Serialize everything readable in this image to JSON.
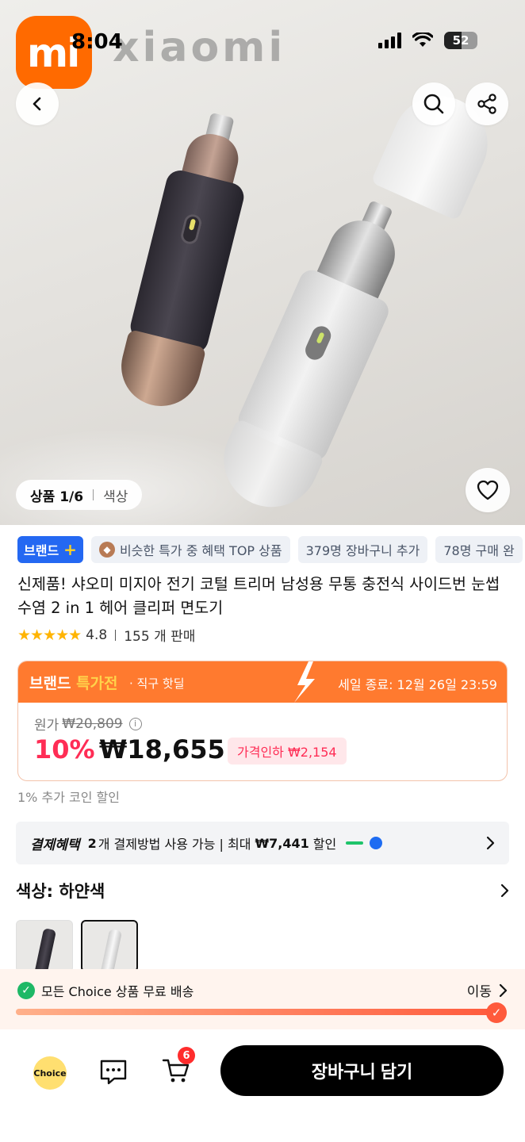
{
  "status": {
    "time": "8:04",
    "battery": "52"
  },
  "hero": {
    "brand_logo": "mi",
    "brand_word": "xiaomi",
    "image_counter": "상품 1/6",
    "image_tab": "색상"
  },
  "tags": {
    "brand": "브랜드",
    "brand_plus": "+",
    "similar": "비슷한 특가 중 혜택 TOP 상품",
    "cart_added": "379명 장바구니 추가",
    "purchased": "78명 구매 완"
  },
  "product": {
    "title": "신제품! 샤오미 미지아 전기 코털 트리머 남성용 무통 충전식 사이드번 눈썹 수염 2 in 1 헤어 클리퍼 면도기",
    "stars": "★★★★★",
    "rating": "4.8",
    "sold": "155 개 판매"
  },
  "promo": {
    "brand_label": "브랜드",
    "sale_label": "특가전",
    "sub": "· 직구 핫딜",
    "end": "세일 종료: 12월 26일 23:59"
  },
  "price": {
    "orig_label": "원가",
    "orig_value": "₩20,809",
    "discount": "10%",
    "current": "₩18,655",
    "price_drop": "가격인하 ₩2,154"
  },
  "coin_text": "1% 추가 코인 할인",
  "payment": {
    "label": "결제혜택",
    "count": "2",
    "text": "개 결제방법 사용 가능 | 최대",
    "max": "₩7,441",
    "suffix": "할인"
  },
  "color": {
    "label": "색상: 하얀색"
  },
  "shipping": {
    "text": "모든 Choice 상품 무료 배송",
    "move": "이동",
    "progress": 1.0
  },
  "bottom": {
    "choice": "Choice",
    "cart_count": "6",
    "add_to_cart": "장바구니 담기"
  }
}
